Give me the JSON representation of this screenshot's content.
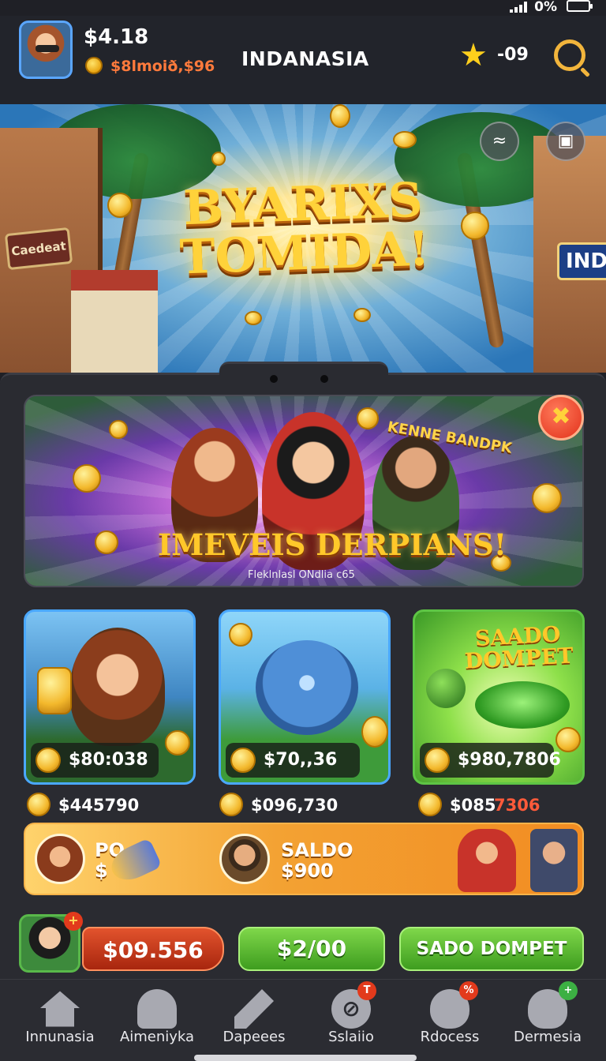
{
  "status": {
    "battery_pct": "0%"
  },
  "header": {
    "balance_main": "$4.18",
    "balance_sub": "$8lmoið,$96",
    "title": "INDANASIA",
    "star_count": "-09"
  },
  "hero": {
    "title_line1": "BYARIXS",
    "title_line2": "TOMIDA!",
    "left_sign": "Caedeat",
    "right_sign": "INDI"
  },
  "promo": {
    "tag": "KENNE BANDPK",
    "title": "IMEVEIS DERPIANS!",
    "subtitle": "Fleklnlasl ONdlia c65",
    "close_symbol": "✖"
  },
  "cards": [
    {
      "price": "$80:038",
      "below": "$445790"
    },
    {
      "price": "$70,,36",
      "below": "$096,730"
    },
    {
      "title": "SAADO DOMPET",
      "price": "$980,7806",
      "below_a": "$085",
      "below_b": "7306"
    }
  ],
  "banner": {
    "left_line1": "PO",
    "left_line2": "$",
    "mid_line1": "SALDO",
    "mid_line2": "$900"
  },
  "actions": {
    "red_button": "$09.556",
    "green_button": "$2/00",
    "wallet_button": "SADO DOMPET",
    "avatar_badge": "+"
  },
  "nav": [
    {
      "label": "Innunasia",
      "icon": "home-icon"
    },
    {
      "label": "Aimeniyka",
      "icon": "profile-icon"
    },
    {
      "label": "Dapeees",
      "icon": "pencil-icon"
    },
    {
      "label": "Sslaiio",
      "icon": "no-sign-icon",
      "badge": "T"
    },
    {
      "label": "Rdocess",
      "icon": "gift-icon",
      "badge": "%"
    },
    {
      "label": "Dermesia",
      "icon": "chat-icon",
      "badge": "+"
    }
  ],
  "colors": {
    "accent_gold": "#ffd23a",
    "accent_green": "#5ec545",
    "accent_red": "#e2311b",
    "background": "#1f2026"
  }
}
